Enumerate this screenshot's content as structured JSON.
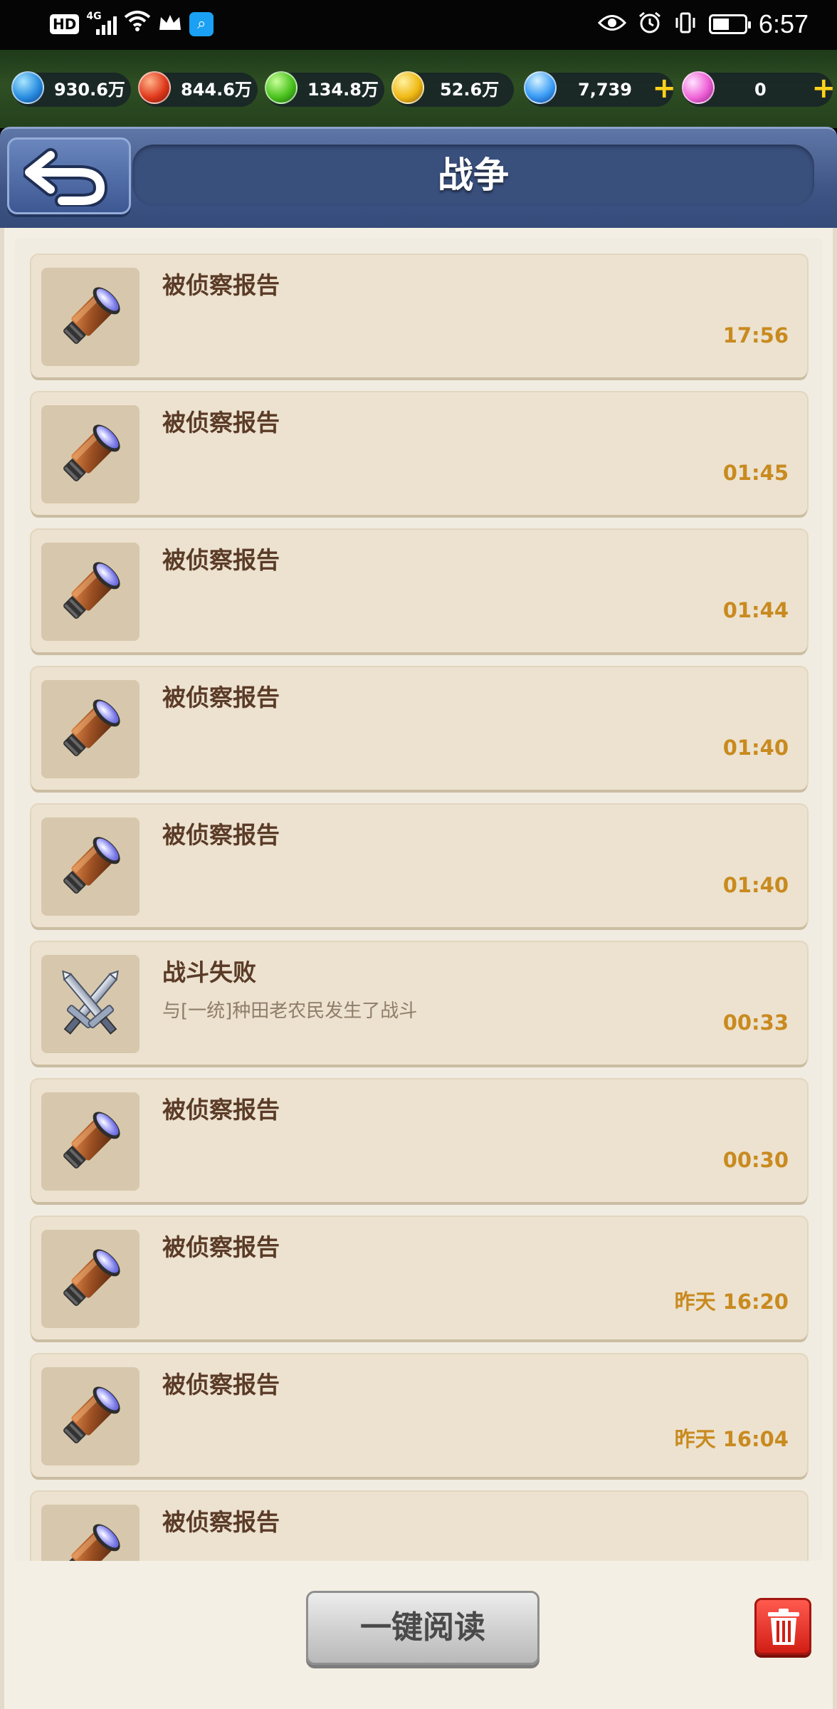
{
  "status_bar": {
    "network_badge": "HD",
    "network_type": "4G",
    "time": "6:57"
  },
  "resources": [
    {
      "icon": "water-orb-icon",
      "value": "930.6万"
    },
    {
      "icon": "fire-orb-icon",
      "value": "844.6万"
    },
    {
      "icon": "leaf-orb-icon",
      "value": "134.8万"
    },
    {
      "icon": "gold-coin-icon",
      "value": "52.6万"
    },
    {
      "icon": "blue-gem-icon",
      "value": "7,739"
    },
    {
      "icon": "pink-diamond-icon",
      "value": "0"
    }
  ],
  "header": {
    "title": "战争",
    "back_icon": "back-arrow-icon"
  },
  "reports": [
    {
      "icon": "telescope-icon",
      "title": "被侦察报告",
      "subtitle": "",
      "time": "17:56"
    },
    {
      "icon": "telescope-icon",
      "title": "被侦察报告",
      "subtitle": "",
      "time": "01:45"
    },
    {
      "icon": "telescope-icon",
      "title": "被侦察报告",
      "subtitle": "",
      "time": "01:44"
    },
    {
      "icon": "telescope-icon",
      "title": "被侦察报告",
      "subtitle": "",
      "time": "01:40"
    },
    {
      "icon": "telescope-icon",
      "title": "被侦察报告",
      "subtitle": "",
      "time": "01:40"
    },
    {
      "icon": "crossed-swords-icon",
      "title": "战斗失败",
      "subtitle": "与[一统]种田老农民发生了战斗",
      "time": "00:33"
    },
    {
      "icon": "telescope-icon",
      "title": "被侦察报告",
      "subtitle": "",
      "time": "00:30"
    },
    {
      "icon": "telescope-icon",
      "title": "被侦察报告",
      "subtitle": "",
      "time": "昨天 16:20"
    },
    {
      "icon": "telescope-icon",
      "title": "被侦察报告",
      "subtitle": "",
      "time": "昨天 16:04"
    },
    {
      "icon": "telescope-icon",
      "title": "被侦察报告",
      "subtitle": "",
      "time": ""
    }
  ],
  "footer": {
    "read_all_label": "一键阅读",
    "delete_icon": "trash-icon"
  },
  "colors": {
    "header_blue": "#3f5585",
    "item_bg": "#ece2cf",
    "time_orange": "#c98a1f",
    "title_brown": "#5a3b27",
    "delete_red": "#d21e15"
  }
}
